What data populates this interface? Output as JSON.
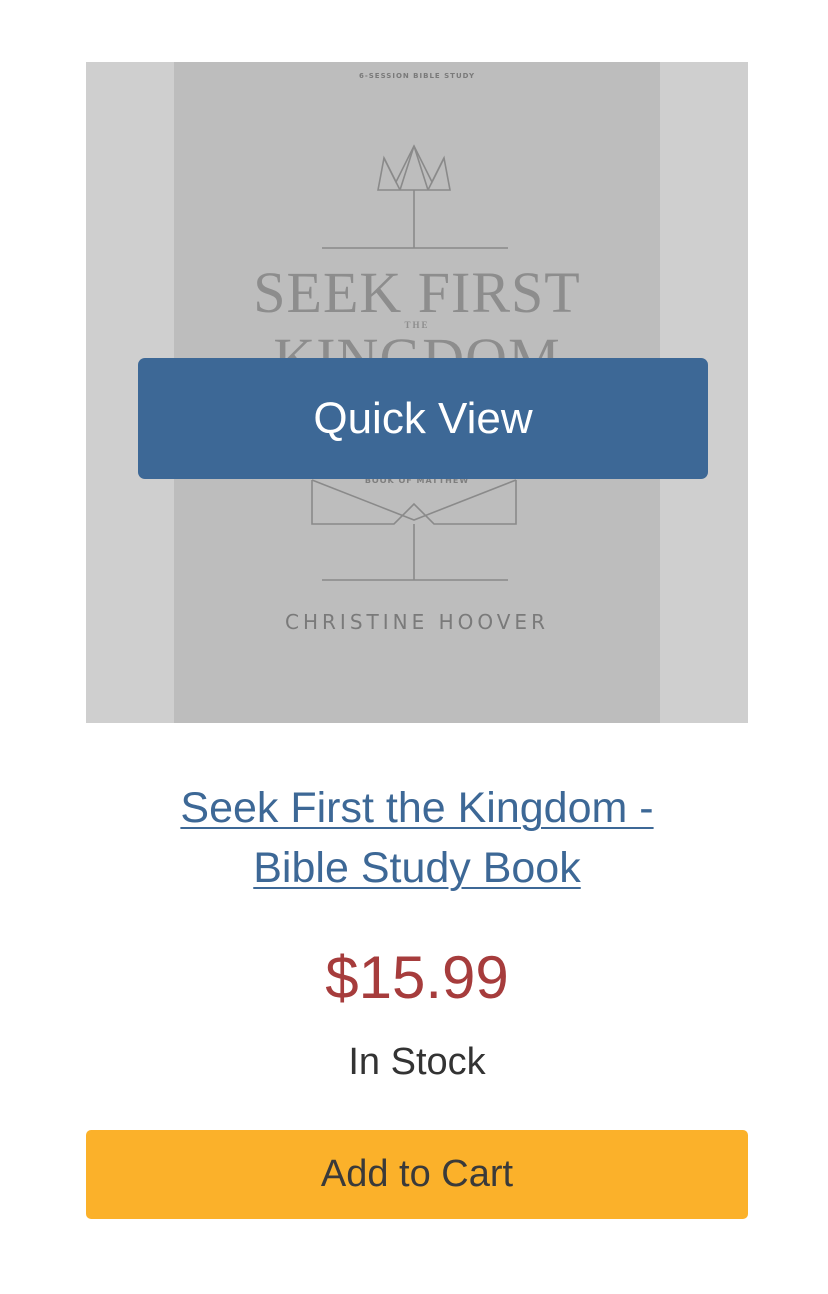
{
  "product": {
    "cover": {
      "overline": "6-SESSION BIBLE STUDY",
      "title_line1": "SEEK FIRST",
      "title_the": "THE",
      "title_line2": "KINGDOM",
      "subtitle": "BOOK OF MATTHEW",
      "author": "CHRISTINE HOOVER",
      "icons": [
        "crown-icon",
        "open-book-icon"
      ]
    },
    "quick_view_label": "Quick View",
    "title_line1": "Seek First the Kingdom -",
    "title_line2": "Bible Study Book",
    "price": "$15.99",
    "stock_status": "In Stock",
    "add_to_cart_label": "Add to Cart"
  },
  "colors": {
    "link": "#3d6896",
    "price": "#a63c3c",
    "quick_view_bg": "#3d6896",
    "cart_button_bg": "#fbb12a",
    "image_overlay": "#cfcfcf"
  }
}
